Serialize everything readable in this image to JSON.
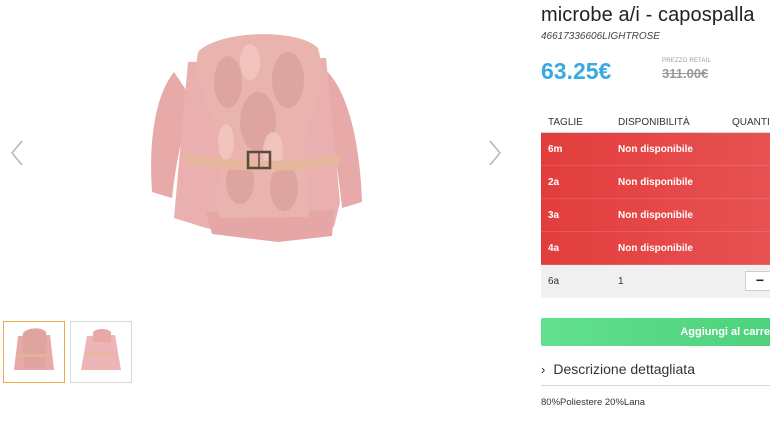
{
  "product": {
    "title": "microbe a/i - capospalla",
    "sku": "46617336606LIGHTROSE",
    "price": "63.25€",
    "retail_label": "PREZZO RETAIL",
    "retail_price": "311.00€"
  },
  "sizes_table": {
    "headers": [
      "TAGLIE",
      "DISPONIBILITÀ",
      "QUANTITÀ"
    ],
    "rows": [
      {
        "size": "6m",
        "availability": "Non disponibile"
      },
      {
        "size": "2a",
        "availability": "Non disponibile"
      },
      {
        "size": "3a",
        "availability": "Non disponibile"
      },
      {
        "size": "4a",
        "availability": "Non disponibile"
      },
      {
        "size": "6a",
        "availability": "1",
        "qty_minus": "−"
      }
    ]
  },
  "cart": {
    "label": "Aggiungi al carrello"
  },
  "description": {
    "toggle_label": "Descrizione dettagliata",
    "chevron": "›",
    "composition": "80%Poliestere 20%Lana"
  },
  "gallery": {
    "prev_icon": "chevron-left-icon",
    "next_icon": "chevron-right-icon"
  },
  "colors": {
    "price": "#38a9e2",
    "unavailable": "#e23d3d",
    "cart": "#5bd884",
    "thumb_active": "#f0a94a"
  }
}
